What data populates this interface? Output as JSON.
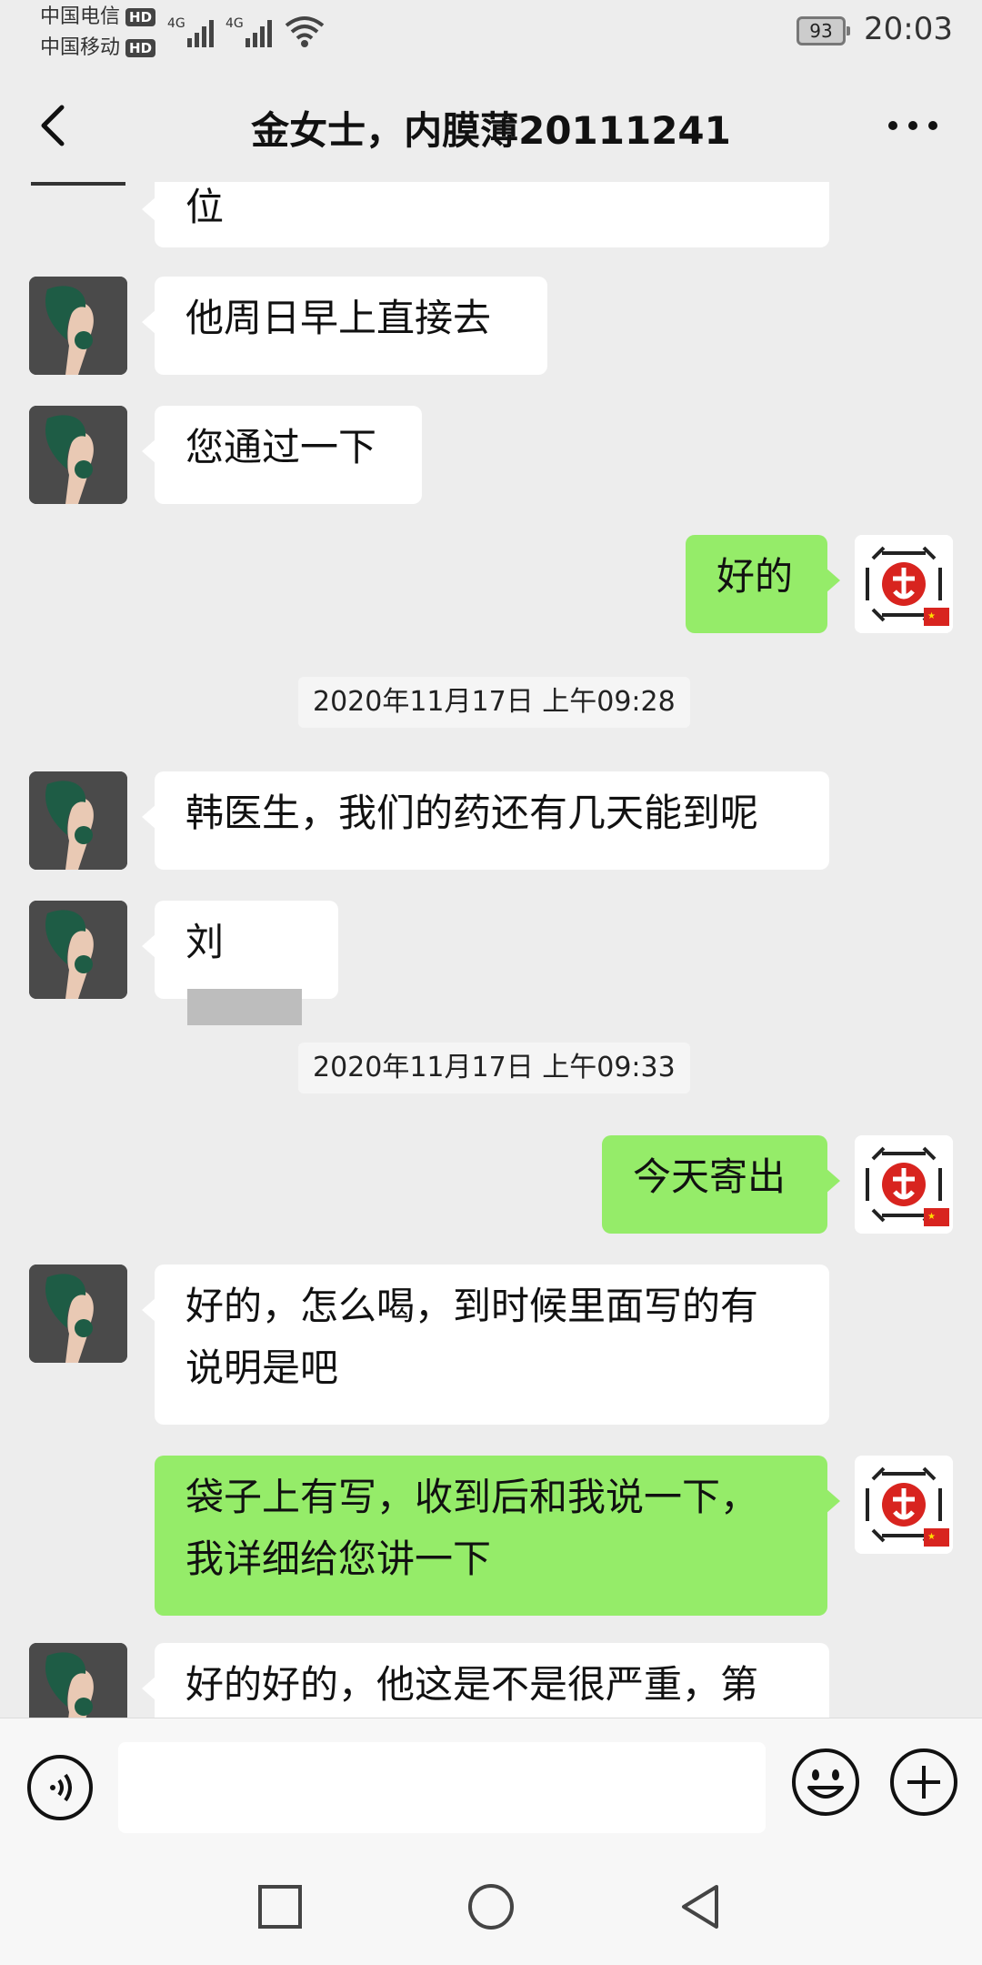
{
  "status_bar": {
    "carrier1": "中国电信",
    "carrier2": "中国移动",
    "hd": "HD",
    "network1": "4G",
    "network2": "4G",
    "battery": "93",
    "time": "20:03"
  },
  "header": {
    "title": "金女士，内膜薄20111241"
  },
  "messages": [
    {
      "side": "in",
      "text": "位"
    },
    {
      "side": "in",
      "text": "他周日早上直接去"
    },
    {
      "side": "in",
      "text": "您通过一下"
    },
    {
      "side": "out",
      "text": "好的"
    },
    {
      "type": "timestamp",
      "text": "2020年11月17日 上午09:28"
    },
    {
      "side": "in",
      "text": "韩医生，我们的药还有几天能到呢"
    },
    {
      "side": "in",
      "text": "刘"
    },
    {
      "type": "timestamp",
      "text": "2020年11月17日 上午09:33"
    },
    {
      "side": "out",
      "text": "今天寄出"
    },
    {
      "side": "in",
      "text": "好的，怎么喝，到时候里面写的有\n说明是吧"
    },
    {
      "side": "out",
      "text": "袋子上有写，收到后和我说一下，\n我详细给您讲一下"
    },
    {
      "side": "in",
      "text": "好的好的，他这是不是很严重，第"
    }
  ],
  "colors": {
    "background": "#ededed",
    "incoming_bubble": "#ffffff",
    "outgoing_bubble": "#95ec69",
    "self_avatar_symbol": "#d8241f"
  },
  "icons": [
    "back-icon",
    "more-icon",
    "voice-icon",
    "emoji-icon",
    "plus-icon",
    "square-nav-icon",
    "circle-nav-icon",
    "triangle-nav-icon"
  ]
}
